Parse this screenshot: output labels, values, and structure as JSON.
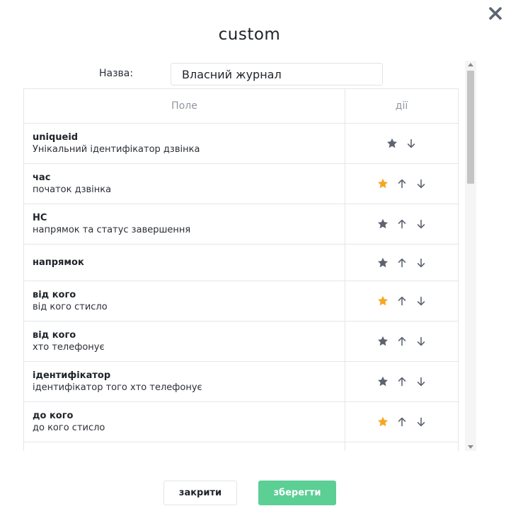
{
  "dialog": {
    "title": "custom"
  },
  "name_field": {
    "label": "Назва:",
    "value": "Власний журнал"
  },
  "table": {
    "columns": [
      "Поле",
      "дії"
    ],
    "rows": [
      {
        "name": "uniqueid",
        "description": "Унікальний ідентифікатор дзвінка",
        "starred": false,
        "up": false,
        "down": true
      },
      {
        "name": "час",
        "description": "початок дзвінка",
        "starred": true,
        "up": true,
        "down": true
      },
      {
        "name": "HC",
        "description": "напрямок та статус завершення",
        "starred": false,
        "up": true,
        "down": true
      },
      {
        "name": "напрямок",
        "description": "",
        "starred": false,
        "up": true,
        "down": true
      },
      {
        "name": "від кого",
        "description": "від кого стисло",
        "starred": true,
        "up": true,
        "down": true
      },
      {
        "name": "від кого",
        "description": "хто телефонує",
        "starred": false,
        "up": true,
        "down": true
      },
      {
        "name": "ідентифікатор",
        "description": "ідентифікатор того хто телефонує",
        "starred": false,
        "up": true,
        "down": true
      },
      {
        "name": "до кого",
        "description": "до кого стисло",
        "starred": true,
        "up": true,
        "down": true
      }
    ]
  },
  "buttons": {
    "close_label": "закрити",
    "save_label": "зберегти"
  },
  "colors": {
    "star_active": "#f5a623",
    "star_inactive": "#5d6470",
    "arrow": "#5d6470",
    "save_button": "#5ccf95"
  },
  "icons": {
    "close": "close-icon",
    "star": "star-icon",
    "up": "arrow-up-icon",
    "down": "arrow-down-icon"
  }
}
